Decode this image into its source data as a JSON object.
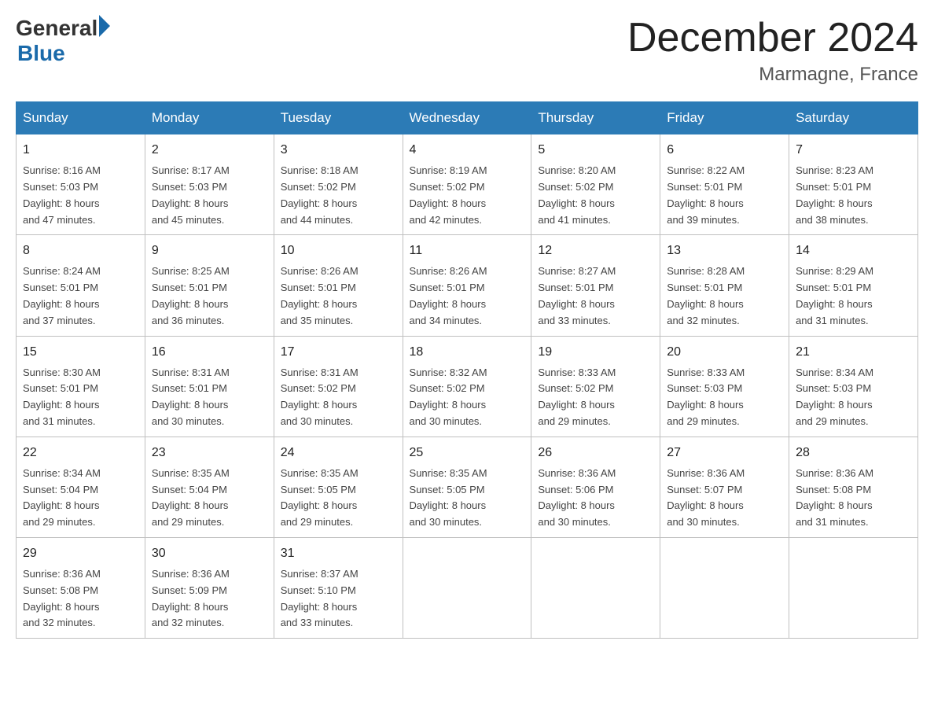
{
  "header": {
    "logo_general": "General",
    "logo_blue": "Blue",
    "title": "December 2024",
    "subtitle": "Marmagne, France"
  },
  "days_of_week": [
    "Sunday",
    "Monday",
    "Tuesday",
    "Wednesday",
    "Thursday",
    "Friday",
    "Saturday"
  ],
  "weeks": [
    [
      {
        "day": "1",
        "sunrise": "Sunrise: 8:16 AM",
        "sunset": "Sunset: 5:03 PM",
        "daylight": "Daylight: 8 hours",
        "daylight2": "and 47 minutes."
      },
      {
        "day": "2",
        "sunrise": "Sunrise: 8:17 AM",
        "sunset": "Sunset: 5:03 PM",
        "daylight": "Daylight: 8 hours",
        "daylight2": "and 45 minutes."
      },
      {
        "day": "3",
        "sunrise": "Sunrise: 8:18 AM",
        "sunset": "Sunset: 5:02 PM",
        "daylight": "Daylight: 8 hours",
        "daylight2": "and 44 minutes."
      },
      {
        "day": "4",
        "sunrise": "Sunrise: 8:19 AM",
        "sunset": "Sunset: 5:02 PM",
        "daylight": "Daylight: 8 hours",
        "daylight2": "and 42 minutes."
      },
      {
        "day": "5",
        "sunrise": "Sunrise: 8:20 AM",
        "sunset": "Sunset: 5:02 PM",
        "daylight": "Daylight: 8 hours",
        "daylight2": "and 41 minutes."
      },
      {
        "day": "6",
        "sunrise": "Sunrise: 8:22 AM",
        "sunset": "Sunset: 5:01 PM",
        "daylight": "Daylight: 8 hours",
        "daylight2": "and 39 minutes."
      },
      {
        "day": "7",
        "sunrise": "Sunrise: 8:23 AM",
        "sunset": "Sunset: 5:01 PM",
        "daylight": "Daylight: 8 hours",
        "daylight2": "and 38 minutes."
      }
    ],
    [
      {
        "day": "8",
        "sunrise": "Sunrise: 8:24 AM",
        "sunset": "Sunset: 5:01 PM",
        "daylight": "Daylight: 8 hours",
        "daylight2": "and 37 minutes."
      },
      {
        "day": "9",
        "sunrise": "Sunrise: 8:25 AM",
        "sunset": "Sunset: 5:01 PM",
        "daylight": "Daylight: 8 hours",
        "daylight2": "and 36 minutes."
      },
      {
        "day": "10",
        "sunrise": "Sunrise: 8:26 AM",
        "sunset": "Sunset: 5:01 PM",
        "daylight": "Daylight: 8 hours",
        "daylight2": "and 35 minutes."
      },
      {
        "day": "11",
        "sunrise": "Sunrise: 8:26 AM",
        "sunset": "Sunset: 5:01 PM",
        "daylight": "Daylight: 8 hours",
        "daylight2": "and 34 minutes."
      },
      {
        "day": "12",
        "sunrise": "Sunrise: 8:27 AM",
        "sunset": "Sunset: 5:01 PM",
        "daylight": "Daylight: 8 hours",
        "daylight2": "and 33 minutes."
      },
      {
        "day": "13",
        "sunrise": "Sunrise: 8:28 AM",
        "sunset": "Sunset: 5:01 PM",
        "daylight": "Daylight: 8 hours",
        "daylight2": "and 32 minutes."
      },
      {
        "day": "14",
        "sunrise": "Sunrise: 8:29 AM",
        "sunset": "Sunset: 5:01 PM",
        "daylight": "Daylight: 8 hours",
        "daylight2": "and 31 minutes."
      }
    ],
    [
      {
        "day": "15",
        "sunrise": "Sunrise: 8:30 AM",
        "sunset": "Sunset: 5:01 PM",
        "daylight": "Daylight: 8 hours",
        "daylight2": "and 31 minutes."
      },
      {
        "day": "16",
        "sunrise": "Sunrise: 8:31 AM",
        "sunset": "Sunset: 5:01 PM",
        "daylight": "Daylight: 8 hours",
        "daylight2": "and 30 minutes."
      },
      {
        "day": "17",
        "sunrise": "Sunrise: 8:31 AM",
        "sunset": "Sunset: 5:02 PM",
        "daylight": "Daylight: 8 hours",
        "daylight2": "and 30 minutes."
      },
      {
        "day": "18",
        "sunrise": "Sunrise: 8:32 AM",
        "sunset": "Sunset: 5:02 PM",
        "daylight": "Daylight: 8 hours",
        "daylight2": "and 30 minutes."
      },
      {
        "day": "19",
        "sunrise": "Sunrise: 8:33 AM",
        "sunset": "Sunset: 5:02 PM",
        "daylight": "Daylight: 8 hours",
        "daylight2": "and 29 minutes."
      },
      {
        "day": "20",
        "sunrise": "Sunrise: 8:33 AM",
        "sunset": "Sunset: 5:03 PM",
        "daylight": "Daylight: 8 hours",
        "daylight2": "and 29 minutes."
      },
      {
        "day": "21",
        "sunrise": "Sunrise: 8:34 AM",
        "sunset": "Sunset: 5:03 PM",
        "daylight": "Daylight: 8 hours",
        "daylight2": "and 29 minutes."
      }
    ],
    [
      {
        "day": "22",
        "sunrise": "Sunrise: 8:34 AM",
        "sunset": "Sunset: 5:04 PM",
        "daylight": "Daylight: 8 hours",
        "daylight2": "and 29 minutes."
      },
      {
        "day": "23",
        "sunrise": "Sunrise: 8:35 AM",
        "sunset": "Sunset: 5:04 PM",
        "daylight": "Daylight: 8 hours",
        "daylight2": "and 29 minutes."
      },
      {
        "day": "24",
        "sunrise": "Sunrise: 8:35 AM",
        "sunset": "Sunset: 5:05 PM",
        "daylight": "Daylight: 8 hours",
        "daylight2": "and 29 minutes."
      },
      {
        "day": "25",
        "sunrise": "Sunrise: 8:35 AM",
        "sunset": "Sunset: 5:05 PM",
        "daylight": "Daylight: 8 hours",
        "daylight2": "and 30 minutes."
      },
      {
        "day": "26",
        "sunrise": "Sunrise: 8:36 AM",
        "sunset": "Sunset: 5:06 PM",
        "daylight": "Daylight: 8 hours",
        "daylight2": "and 30 minutes."
      },
      {
        "day": "27",
        "sunrise": "Sunrise: 8:36 AM",
        "sunset": "Sunset: 5:07 PM",
        "daylight": "Daylight: 8 hours",
        "daylight2": "and 30 minutes."
      },
      {
        "day": "28",
        "sunrise": "Sunrise: 8:36 AM",
        "sunset": "Sunset: 5:08 PM",
        "daylight": "Daylight: 8 hours",
        "daylight2": "and 31 minutes."
      }
    ],
    [
      {
        "day": "29",
        "sunrise": "Sunrise: 8:36 AM",
        "sunset": "Sunset: 5:08 PM",
        "daylight": "Daylight: 8 hours",
        "daylight2": "and 32 minutes."
      },
      {
        "day": "30",
        "sunrise": "Sunrise: 8:36 AM",
        "sunset": "Sunset: 5:09 PM",
        "daylight": "Daylight: 8 hours",
        "daylight2": "and 32 minutes."
      },
      {
        "day": "31",
        "sunrise": "Sunrise: 8:37 AM",
        "sunset": "Sunset: 5:10 PM",
        "daylight": "Daylight: 8 hours",
        "daylight2": "and 33 minutes."
      },
      {
        "day": "",
        "sunrise": "",
        "sunset": "",
        "daylight": "",
        "daylight2": ""
      },
      {
        "day": "",
        "sunrise": "",
        "sunset": "",
        "daylight": "",
        "daylight2": ""
      },
      {
        "day": "",
        "sunrise": "",
        "sunset": "",
        "daylight": "",
        "daylight2": ""
      },
      {
        "day": "",
        "sunrise": "",
        "sunset": "",
        "daylight": "",
        "daylight2": ""
      }
    ]
  ]
}
